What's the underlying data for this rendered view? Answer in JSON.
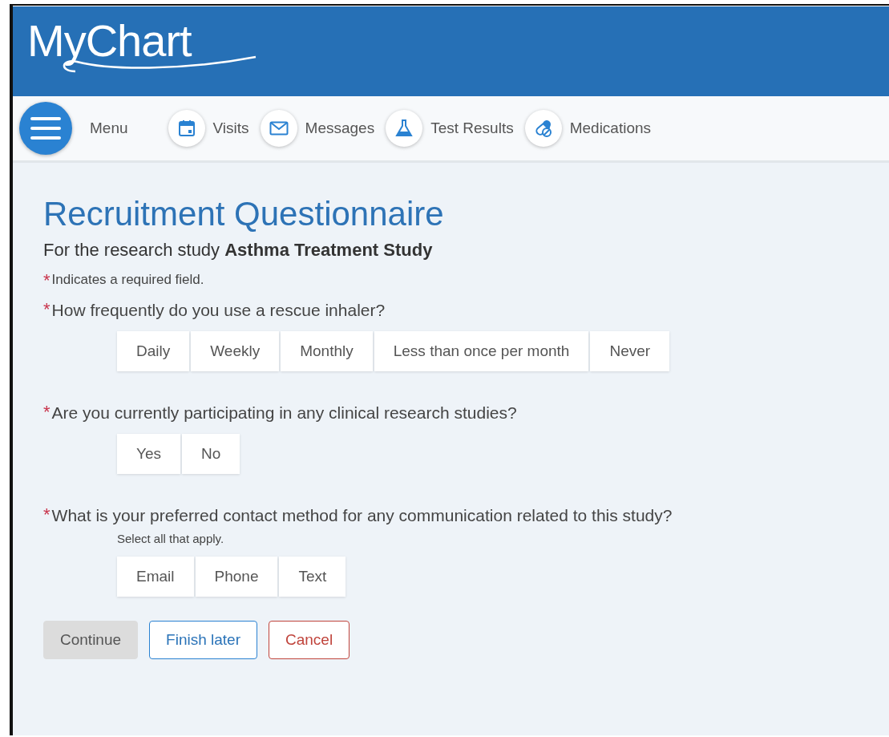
{
  "logo": "MyChart",
  "nav": [
    {
      "label": "Menu",
      "kind": "menu"
    },
    {
      "label": "Visits",
      "kind": "calendar"
    },
    {
      "label": "Messages",
      "kind": "envelope"
    },
    {
      "label": "Test Results",
      "kind": "flask"
    },
    {
      "label": "Medications",
      "kind": "pills"
    }
  ],
  "title": "Recruitment Questionnaire",
  "subtitle": "For the research study **Asthma Treatment Study**",
  "required_mark": "*",
  "required_note": "Indicates a required field.",
  "questions": [
    {
      "text": "How frequently do you use a rescue inhaler?",
      "required": true,
      "options": [
        {
          "label": "Daily",
          "selected": false
        },
        {
          "label": "Weekly",
          "selected": false
        },
        {
          "label": "Monthly",
          "selected": false
        },
        {
          "label": "Less than once per month",
          "selected": false
        },
        {
          "label": "Never",
          "selected": false
        }
      ]
    },
    {
      "text": "Are you currently participating in any clinical research studies?",
      "required": true,
      "options": [
        {
          "label": "Yes",
          "selected": false
        },
        {
          "label": "No",
          "selected": false
        }
      ]
    },
    {
      "text": "What is your preferred contact method for any communication related to this study?",
      "required": true,
      "hint": "Select all that apply.",
      "options": [
        {
          "label": "Email",
          "selected": false
        },
        {
          "label": "Phone",
          "selected": false
        },
        {
          "label": "Text",
          "selected": false
        }
      ]
    }
  ],
  "buttons": [
    {
      "label": "Continue",
      "kind": "primary",
      "disabled": true
    },
    {
      "label": "Finish later",
      "kind": "secondary",
      "disabled": false
    },
    {
      "label": "Cancel",
      "kind": "danger",
      "disabled": false
    }
  ]
}
